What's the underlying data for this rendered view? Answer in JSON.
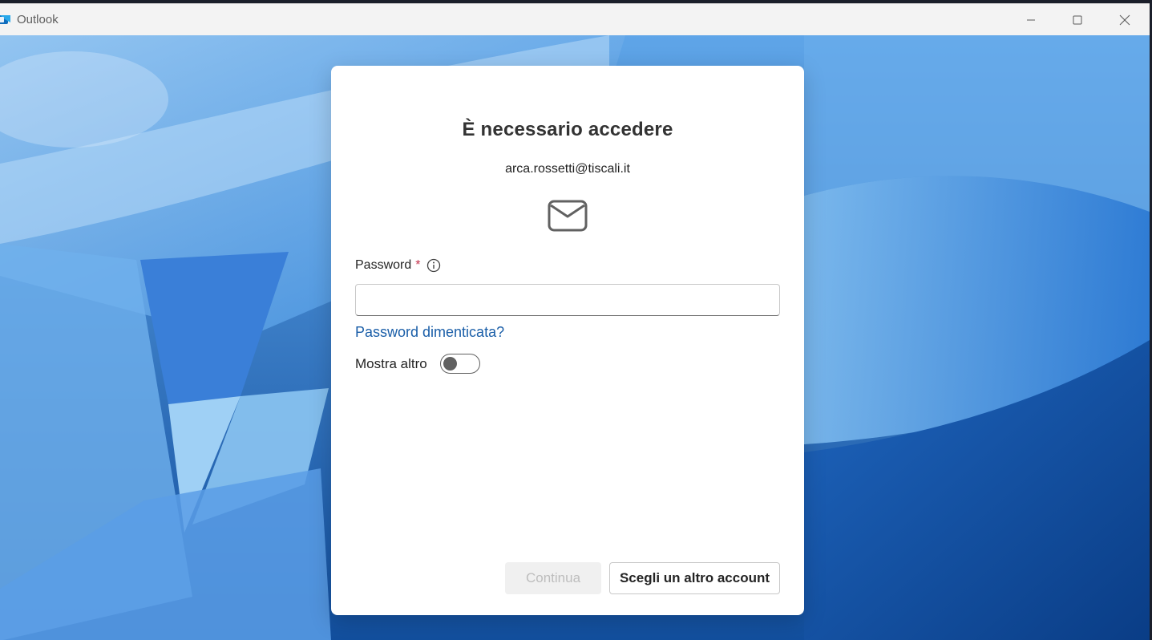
{
  "window": {
    "app_name": "Outlook",
    "app_icon": "outlook-icon"
  },
  "dialog": {
    "title": "È necessario accedere",
    "email": "arca.rossetti@tiscali.it",
    "icon": "mail-icon",
    "password": {
      "label": "Password",
      "required_mark": "*",
      "value": "",
      "placeholder": ""
    },
    "forgot_link": "Password dimenticata?",
    "show_more": {
      "label": "Mostra altro",
      "on": false
    },
    "buttons": {
      "continue": "Continua",
      "other_account": "Scegli un altro account"
    }
  },
  "colors": {
    "link": "#1a5ea8",
    "required": "#c4314b",
    "backdrop": "#2f7fd6"
  }
}
